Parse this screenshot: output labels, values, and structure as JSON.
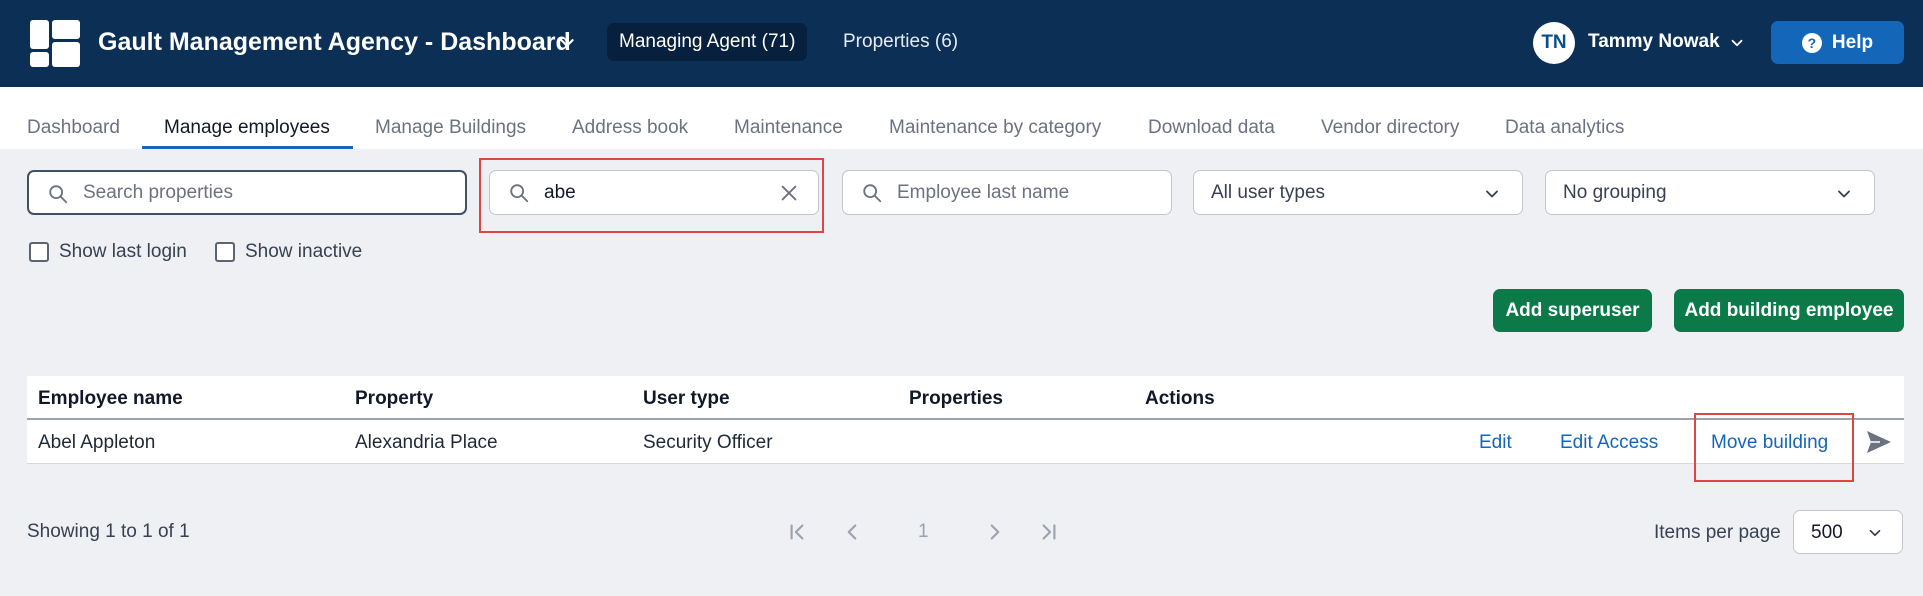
{
  "header": {
    "app_title": "Gault Management Agency - Dashboard",
    "nav": [
      "Managing Agent (71)",
      "Properties (6)"
    ],
    "user": {
      "initials": "TN",
      "name": "Tammy Nowak"
    },
    "help_label": "Help",
    "colors": {
      "topbar": "#0b2f55",
      "help": "#1466b8"
    }
  },
  "tabs": [
    "Dashboard",
    "Manage employees",
    "Manage Buildings",
    "Address book",
    "Maintenance",
    "Maintenance by category",
    "Download data",
    "Vendor directory",
    "Data analytics"
  ],
  "active_tab": "Manage employees",
  "filters": {
    "search_properties": {
      "placeholder": "Search properties",
      "value": ""
    },
    "search_employee": {
      "value": "abe"
    },
    "employee_last_name": {
      "placeholder": "Employee last name",
      "value": ""
    },
    "user_types": {
      "selected": "All user types"
    },
    "grouping": {
      "selected": "No grouping"
    },
    "show_last_login": {
      "label": "Show last login",
      "checked": false
    },
    "show_inactive": {
      "label": "Show inactive",
      "checked": false
    }
  },
  "buttons": {
    "add_superuser": "Add superuser",
    "add_building_employee": "Add building employee",
    "accent": "#0b7a48"
  },
  "table": {
    "columns": [
      "Employee name",
      "Property",
      "User type",
      "Properties",
      "Actions"
    ],
    "rows": [
      {
        "employee_name": "Abel Appleton",
        "property": "Alexandria Place",
        "user_type": "Security Officer",
        "properties": "",
        "actions": [
          "Edit",
          "Edit Access",
          "Move building"
        ]
      }
    ]
  },
  "pagination": {
    "summary": "Showing 1 to 1 of 1",
    "current_page": "1",
    "items_per_page_label": "Items per page",
    "items_per_page": "500"
  }
}
